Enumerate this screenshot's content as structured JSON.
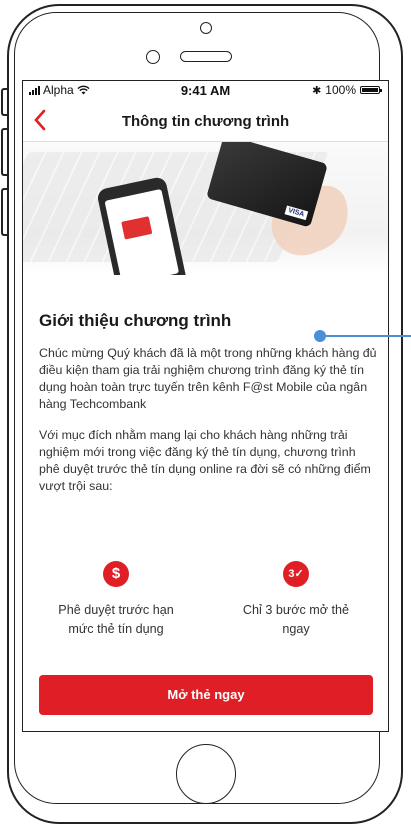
{
  "status_bar": {
    "carrier": "Alpha",
    "time": "9:41 AM",
    "battery": "100%",
    "battery_level": 1.0
  },
  "nav": {
    "title": "Thông tin chương trình",
    "back_icon": "chevron-left-icon"
  },
  "hero": {
    "card_brand": "VISA"
  },
  "intro": {
    "title": "Giới thiệu chương trình",
    "paragraph1": "Chúc mừng Quý khách đã là một trong những khách hàng đủ điều kiện tham gia trải nghiệm chương trình đăng ký thẻ tín dụng hoàn toàn trực tuyến trên kênh F@st Mobile của ngân hàng Techcombank",
    "paragraph2": "Với mục đích nhằm mang lại cho khách hàng những trải nghiệm mới trong việc đăng ký thẻ tín dụng, chương trình phê duyệt trước thẻ tín dụng online ra đời sẽ có những điểm vượt trội sau:"
  },
  "features": [
    {
      "icon": "dollar-icon",
      "icon_text": "$",
      "label": "Phê duyệt trước hạn mức thẻ tín dụng"
    },
    {
      "icon": "three-steps-icon",
      "icon_text": "3✓",
      "label": "Chỉ 3 bước mở thẻ ngay"
    }
  ],
  "cta": {
    "label": "Mở thẻ ngay"
  },
  "colors": {
    "brand": "#e01e26",
    "annotation": "#4a8fd8"
  }
}
